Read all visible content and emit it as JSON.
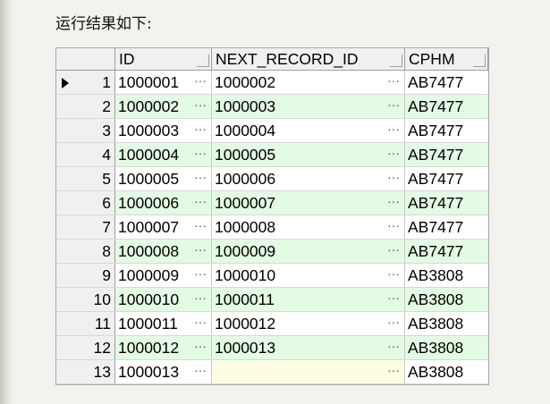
{
  "caption": "运行结果如下:",
  "columns": [
    "ID",
    "NEXT_RECORD_ID",
    "CPHM"
  ],
  "rows": [
    {
      "num": "1",
      "id": "1000001",
      "next": "1000002",
      "cphm": "AB7477"
    },
    {
      "num": "2",
      "id": "1000002",
      "next": "1000003",
      "cphm": "AB7477"
    },
    {
      "num": "3",
      "id": "1000003",
      "next": "1000004",
      "cphm": "AB7477"
    },
    {
      "num": "4",
      "id": "1000004",
      "next": "1000005",
      "cphm": "AB7477"
    },
    {
      "num": "5",
      "id": "1000005",
      "next": "1000006",
      "cphm": "AB7477"
    },
    {
      "num": "6",
      "id": "1000006",
      "next": "1000007",
      "cphm": "AB7477"
    },
    {
      "num": "7",
      "id": "1000007",
      "next": "1000008",
      "cphm": "AB7477"
    },
    {
      "num": "8",
      "id": "1000008",
      "next": "1000009",
      "cphm": "AB7477"
    },
    {
      "num": "9",
      "id": "1000009",
      "next": "1000010",
      "cphm": "AB3808"
    },
    {
      "num": "10",
      "id": "1000010",
      "next": "1000011",
      "cphm": "AB3808"
    },
    {
      "num": "11",
      "id": "1000011",
      "next": "1000012",
      "cphm": "AB3808"
    },
    {
      "num": "12",
      "id": "1000012",
      "next": "1000013",
      "cphm": "AB3808"
    },
    {
      "num": "13",
      "id": "1000013",
      "next": "",
      "cphm": "AB3808"
    }
  ],
  "ellipsis": "···",
  "current_row": 1,
  "colors": {
    "alt_row": "#e3fae3",
    "empty_cell": "#fdfde3"
  }
}
